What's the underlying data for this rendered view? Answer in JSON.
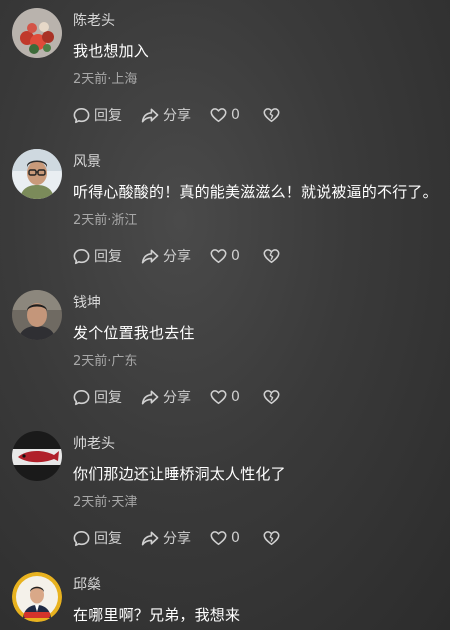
{
  "comments": [
    {
      "username": "陈老头",
      "text": "我也想加入",
      "meta": "2天前·上海",
      "reply_label": "回复",
      "share_label": "分享",
      "like_count": "0",
      "avatar": "flowers-photo"
    },
    {
      "username": "风景",
      "text": "听得心酸酸的！真的能美滋滋么！就说被逼的不行了。",
      "meta": "2天前·浙江",
      "reply_label": "回复",
      "share_label": "分享",
      "like_count": "0",
      "avatar": "man-with-glasses-photo"
    },
    {
      "username": "钱坤",
      "text": "发个位置我也去住",
      "meta": "2天前·广东",
      "reply_label": "回复",
      "share_label": "分享",
      "like_count": "0",
      "avatar": "man-portrait-photo"
    },
    {
      "username": "帅老头",
      "text": "你们那边还让睡桥洞太人性化了",
      "meta": "2天前·天津",
      "reply_label": "回复",
      "share_label": "分享",
      "like_count": "0",
      "avatar": "red-fish-photo"
    },
    {
      "username": "邱燊",
      "text": "在哪里啊？兄弟，我想来",
      "avatar": "man-in-suit-badge-photo"
    }
  ],
  "colors": {
    "background": "#3a3a3a",
    "text": "#ffffff",
    "meta_text": "#a8a8a8",
    "username_text": "#d8d8d8"
  }
}
